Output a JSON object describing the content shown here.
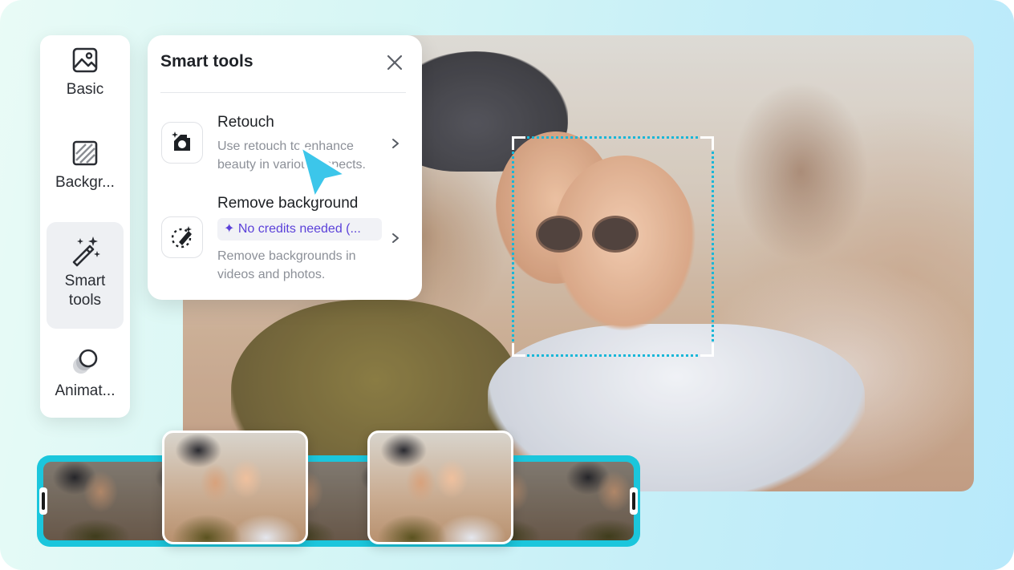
{
  "sidebar": {
    "items": [
      {
        "label": "Basic",
        "icon": "image-icon"
      },
      {
        "label": "Backgr...",
        "icon": "background-pattern-icon"
      },
      {
        "label": "Smart tools",
        "icon": "magic-wand-icon",
        "active": true
      },
      {
        "label": "Animat...",
        "icon": "animation-circles-icon"
      }
    ]
  },
  "panel": {
    "title": "Smart tools",
    "close_icon": "close-icon",
    "tools": [
      {
        "name": "Retouch",
        "description": "Use retouch to enhance beauty in various aspects.",
        "icon": "retouch-icon"
      },
      {
        "name": "Remove background",
        "badge": "✦ No credits needed (...",
        "description": "Remove backgrounds in videos and photos.",
        "icon": "remove-background-icon"
      }
    ]
  },
  "colors": {
    "accent": "#1bc6dc",
    "badge_text": "#5b41d9",
    "selection": "#18b7d8"
  }
}
